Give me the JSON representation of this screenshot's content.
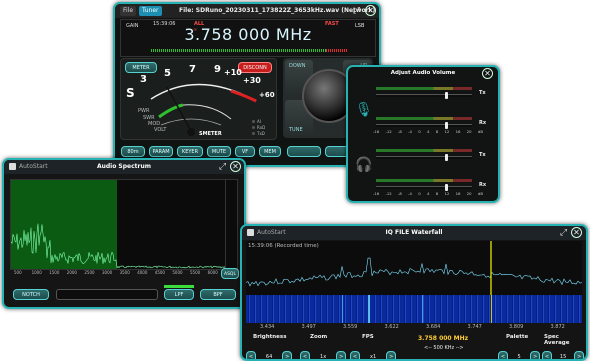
{
  "radio": {
    "tabs": [
      "File",
      "Tuner"
    ],
    "file_title": "File: SDRuno_20230311_173822Z_3653kHz.wav (Network)",
    "gain_label": "GAIN",
    "time": "15:39:06",
    "all_label": "ALL",
    "fast_label": "FAST",
    "mode_label": "LSB",
    "frequency": "3.758 000 MHz",
    "meter_btn": "METER",
    "disconn_btn": "DISCONN",
    "scale_numbers": [
      "3",
      "5",
      "7",
      "9",
      "+10",
      "+30",
      "+60"
    ],
    "s_letter": "S",
    "meter_labels": [
      "PWR",
      "SWR",
      "MOD",
      "VOLT"
    ],
    "smeter_label": "SMETER",
    "radio_opts": [
      "AI",
      "RxD",
      "TxD"
    ],
    "down_label": "DOWN",
    "up_label": "UP",
    "tune_label": "TUNE",
    "bottom_buttons": [
      "80m",
      "PARAM",
      "KEYER",
      "MUTE",
      "VF",
      "MEM"
    ]
  },
  "audio_volume": {
    "title": "Adjust Audio Volume",
    "scale": [
      "-16",
      "-12",
      "-8",
      "-4",
      "0",
      "4",
      "8",
      "12",
      "16",
      "20",
      "dB"
    ],
    "rows": [
      {
        "label": "Tx",
        "level": 0.72
      },
      {
        "label": "Rx",
        "level": 0.72
      },
      {
        "label": "Tx",
        "level": 0.72
      },
      {
        "label": "Rx",
        "level": 0.72
      }
    ]
  },
  "spectrum": {
    "autostart": "AutoStart",
    "title": "Audio Spectrum",
    "x_ticks": [
      "500",
      "1000",
      "1500",
      "2000",
      "2500",
      "3000",
      "3500",
      "4000",
      "4500",
      "5000",
      "5500",
      "6000"
    ],
    "notch_btn": "NOTCH",
    "lpf_btn": "LPF",
    "bpf_btn": "BPF",
    "asql_btn": "ASQL",
    "passband_end_hz": 3000,
    "colors": {
      "passband": "#0b5c12",
      "trace": "#7fffb0"
    }
  },
  "waterfall": {
    "autostart": "AutoStart",
    "title": "IQ FILE Waterfall",
    "recorded": "15:39:06 (Recorded time)",
    "freq_ticks": [
      "3.434",
      "3.497",
      "3.559",
      "3.622",
      "3.684",
      "3.747",
      "3.809",
      "3.872"
    ],
    "brightness_label": "Brightness",
    "brightness_val": "64",
    "zoom_label": "Zoom",
    "zoom_val": "1x",
    "fps_label": "FPS",
    "fps_val": "x1",
    "center_freq": "3.758 000 MHz",
    "span": "<-- 500 KHz -->",
    "palette_label": "Palette",
    "palette_val": "5",
    "spec_avg_label": "Spec Average",
    "spec_avg_val": "15",
    "colors": {
      "marker": "#c8c800",
      "trace": "#7fe3ff"
    }
  }
}
